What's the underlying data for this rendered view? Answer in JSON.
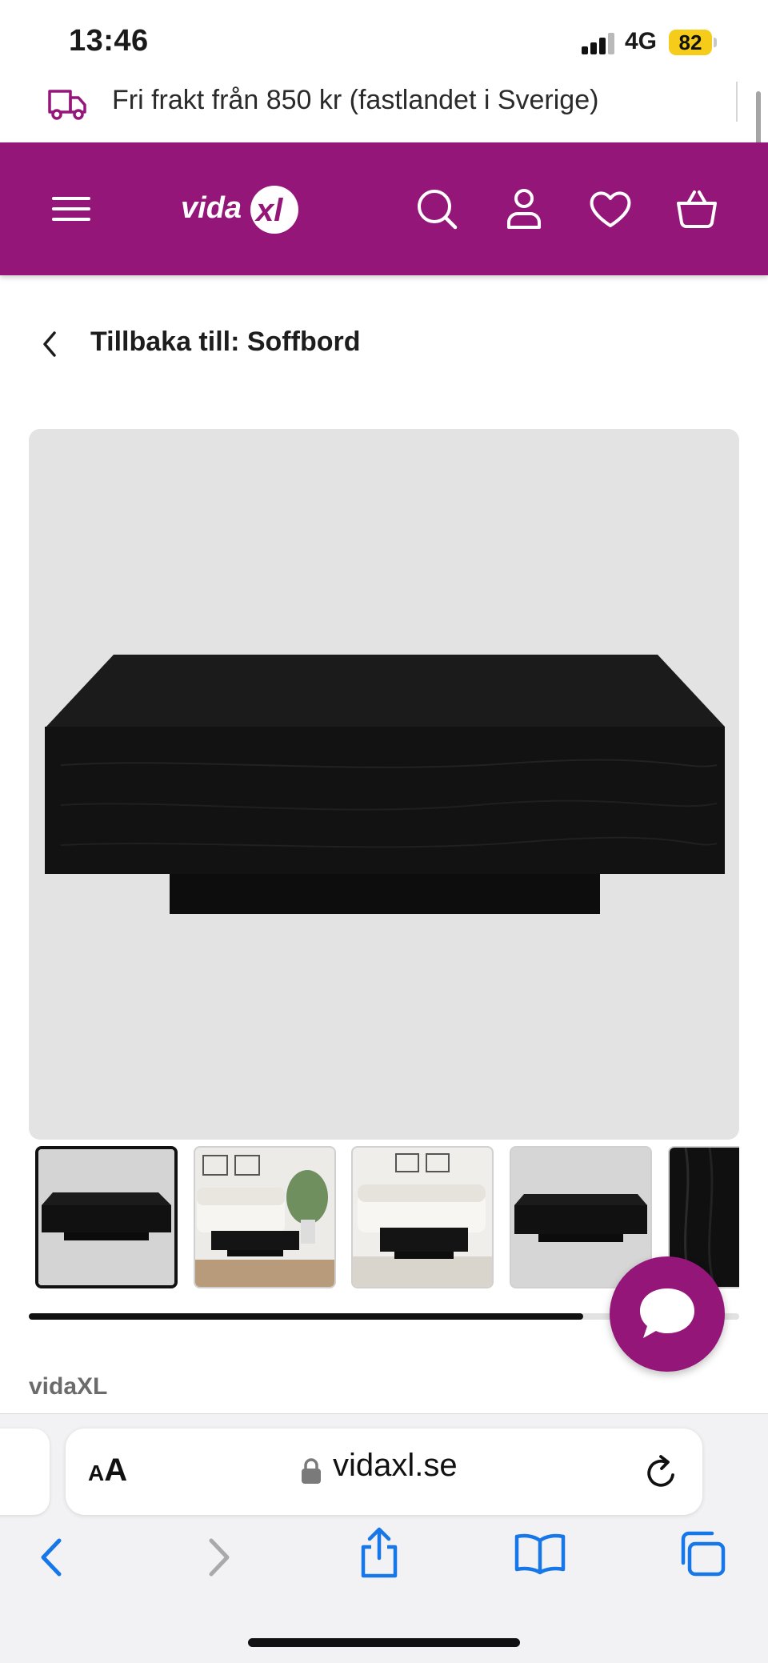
{
  "status_bar": {
    "time": "13:46",
    "network": "4G",
    "battery": "82"
  },
  "shipping_banner": {
    "text": "Fri frakt från 850 kr (fastlandet i Sverige)",
    "icon": "delivery-truck-icon"
  },
  "header": {
    "background": "#951679",
    "logo": "vidaXL",
    "icons": [
      "menu-icon",
      "search-icon",
      "account-icon",
      "wishlist-heart-icon",
      "cart-basket-icon"
    ]
  },
  "breadcrumb": {
    "back_label": "Tillbaka till: Soffbord"
  },
  "gallery": {
    "thumbnails": [
      "thumb-product-front",
      "thumb-living-room-1",
      "thumb-living-room-2",
      "thumb-product-side",
      "thumb-wood-detail"
    ],
    "selected_index": 0,
    "scroll_progress": 0.78
  },
  "product": {
    "brand": "vidaXL"
  },
  "chat": {
    "icon": "chat-bubble-icon"
  },
  "browser": {
    "text_size_label": "AA",
    "url": "vidaxl.se",
    "toolbar": [
      "back-icon",
      "forward-icon",
      "share-icon",
      "bookmarks-icon",
      "tabs-icon"
    ]
  }
}
